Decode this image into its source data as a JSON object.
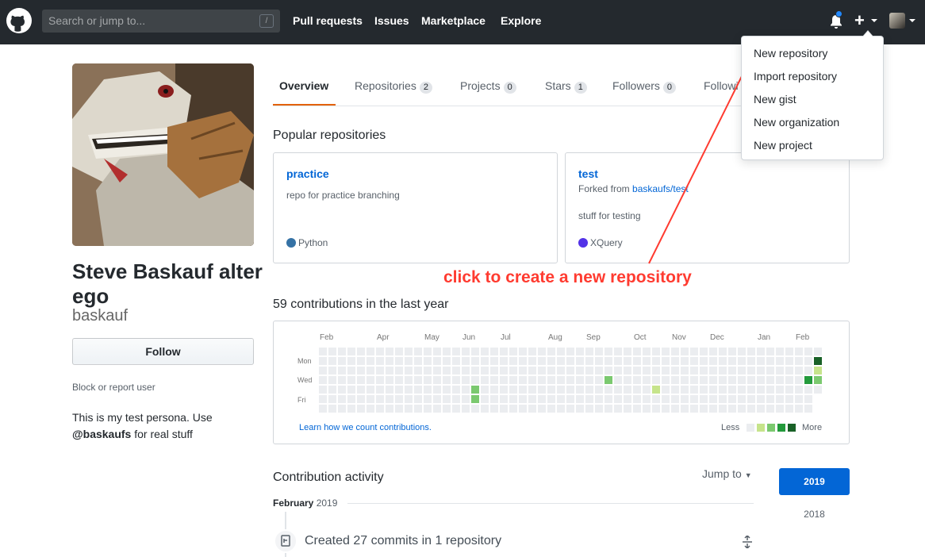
{
  "header": {
    "search_placeholder": "Search or jump to...",
    "search_key": "/",
    "nav": [
      "Pull requests",
      "Issues",
      "Marketplace",
      "Explore"
    ],
    "plus_label": "+"
  },
  "dropdown": {
    "items": [
      "New repository",
      "Import repository",
      "New gist",
      "New organization",
      "New project"
    ]
  },
  "profile": {
    "name": "Steve Baskauf alter ego",
    "username": "baskauf",
    "follow_label": "Follow",
    "block_label": "Block or report user",
    "bio_line1": "This is my test persona. Use",
    "bio_handle": "@baskaufs",
    "bio_line2": " for real stuff"
  },
  "tabs": [
    {
      "label": "Overview",
      "count": null
    },
    {
      "label": "Repositories",
      "count": "2"
    },
    {
      "label": "Projects",
      "count": "0"
    },
    {
      "label": "Stars",
      "count": "1"
    },
    {
      "label": "Followers",
      "count": "0"
    },
    {
      "label": "Followi",
      "count": null
    }
  ],
  "popular": {
    "heading": "Popular repositories",
    "repos": [
      {
        "name": "practice",
        "description": "repo for practice branching",
        "forked_prefix": "",
        "forked_link": "",
        "language": "Python",
        "language_color": "#3572A5"
      },
      {
        "name": "test",
        "description": "stuff for testing",
        "forked_prefix": "Forked from ",
        "forked_link": "baskaufs/test",
        "language": "XQuery",
        "language_color": "#5232e7"
      }
    ]
  },
  "annotation": "click to create a new repository",
  "contributions": {
    "heading": "59 contributions in the last year",
    "months": [
      "Feb",
      "Apr",
      "May",
      "Jun",
      "Jul",
      "Aug",
      "Sep",
      "Oct",
      "Nov",
      "Dec",
      "Jan",
      "Feb"
    ],
    "days": [
      "Mon",
      "Wed",
      "Fri"
    ],
    "learn_link": "Learn how we count contributions.",
    "legend_less": "Less",
    "legend_more": "More",
    "colors": [
      "#ebedf0",
      "#c6e48b",
      "#7bc96f",
      "#239a3b",
      "#196127"
    ]
  },
  "activity": {
    "heading": "Contribution activity",
    "jump_label": "Jump to",
    "years": [
      "2019",
      "2018"
    ],
    "month_label": "February",
    "month_year": " 2019",
    "entry": "Created 27 commits in 1 repository"
  }
}
